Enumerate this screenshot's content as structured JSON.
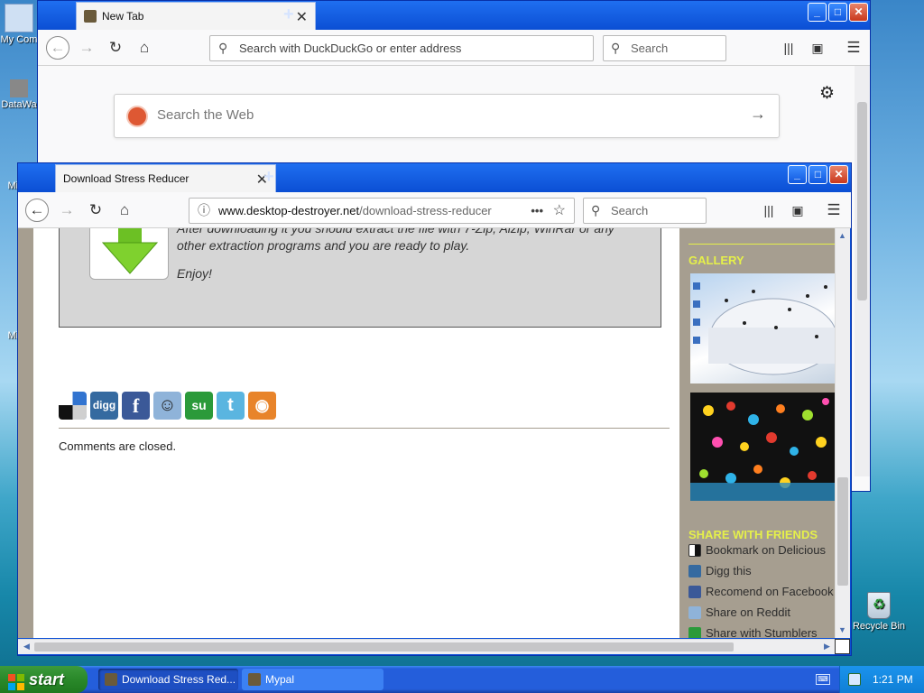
{
  "desktop": {
    "icons": [
      {
        "label": "My Com"
      },
      {
        "label": "DataWa"
      },
      {
        "label": "Mic"
      },
      {
        "label": "Mic"
      },
      {
        "label": "Recycle Bin"
      }
    ]
  },
  "back_window": {
    "tab_title": "New Tab",
    "address_placeholder": "Search with DuckDuckGo or enter address",
    "search_placeholder": "Search",
    "web_search_placeholder": "Search the Web"
  },
  "front_window": {
    "tab_title": "Download Stress Reducer",
    "url_domain": "www.desktop-destroyer.net",
    "url_path": "/download-stress-reducer",
    "search_placeholder": "Search",
    "page": {
      "instructions_line1": "After downloading it you should extract the file with 7-Zip, Alzip, WinRar or any",
      "instructions_line2": "other extraction programs and you are ready to play.",
      "enjoy": "Enjoy!",
      "comments_closed": "Comments are closed.",
      "gallery_heading": "GALLERY",
      "share_heading": "SHARE WITH FRIENDS",
      "share_links": [
        {
          "label": "Bookmark on Delicious",
          "icon": "delicious-icon",
          "color": "#222222"
        },
        {
          "label": "Digg this",
          "icon": "digg-icon",
          "color": "#356aa0"
        },
        {
          "label": "Recomend on Facebook",
          "icon": "facebook-icon",
          "color": "#3b5998"
        },
        {
          "label": "Share on Reddit",
          "icon": "reddit-icon",
          "color": "#8fb3d9"
        },
        {
          "label": "Share with Stumblers",
          "icon": "stumbleupon-icon",
          "color": "#2b9a3a"
        }
      ],
      "social_buttons": [
        {
          "icon": "delicious-icon",
          "glyph": "",
          "color": "#222222"
        },
        {
          "icon": "digg-icon",
          "glyph": "digg",
          "color": "#356aa0"
        },
        {
          "icon": "facebook-icon",
          "glyph": "f",
          "color": "#3b5998"
        },
        {
          "icon": "reddit-icon",
          "glyph": "☺",
          "color": "#8fb3d9"
        },
        {
          "icon": "stumbleupon-icon",
          "glyph": "su",
          "color": "#2b9a3a"
        },
        {
          "icon": "twitter-icon",
          "glyph": "t",
          "color": "#5ab5e0"
        },
        {
          "icon": "rss-icon",
          "glyph": "◉",
          "color": "#e8842a"
        }
      ],
      "accent_color": "#e5f04a",
      "sidebar_color": "#a69e90"
    }
  },
  "taskbar": {
    "start_label": "start",
    "buttons": [
      {
        "label": "Download Stress Red..."
      },
      {
        "label": "Mypal"
      }
    ],
    "clock": "1:21 PM"
  }
}
